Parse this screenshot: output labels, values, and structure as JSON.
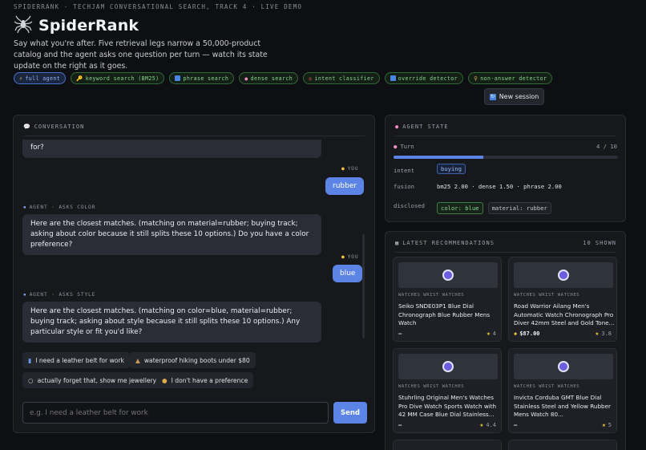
{
  "header": {
    "topline": "SPIDERRANK · TECHJAM CONVERSATIONAL SEARCH, TRACK 4 · LIVE DEMO",
    "title": "SpiderRank",
    "tagline": "Say what you're after. Five retrieval legs narrow a 50,000-product catalog and the agent asks one question per turn — watch its state update on the right as it goes."
  },
  "chips": [
    {
      "label": "full agent",
      "icon": "lightning-icon"
    },
    {
      "label": "keyword search (BM25)",
      "icon": "key-icon"
    },
    {
      "label": "phrase search",
      "icon": "phrase-icon"
    },
    {
      "label": "dense search",
      "icon": "brain-icon"
    },
    {
      "label": "intent classifier",
      "icon": "target-icon"
    },
    {
      "label": "override detector",
      "icon": "override-icon"
    },
    {
      "label": "non-answer detector",
      "icon": "magnifier-icon"
    }
  ],
  "new_session_label": "New session",
  "conversation": {
    "title": "CONVERSATION",
    "messages": {
      "agent_partial": "for?",
      "user1_role": "YOU",
      "user1_text": "rubber",
      "agent1_role": "AGENT · ASKS COLOR",
      "agent1_text": "Here are the closest matches. (matching on material=rubber; buying track; asking about color because it still splits these 10 options.) Do you have a color preference?",
      "user2_role": "YOU",
      "user2_text": "blue",
      "agent2_role": "AGENT · ASKS STYLE",
      "agent2_text": "Here are the closest matches. (matching on color=blue, material=rubber; buying track; asking about style because it still splits these 10 options.) Any particular style or fit you'd like?"
    },
    "suggestions": [
      {
        "label": "I need a leather belt for work",
        "icon": "belt-icon"
      },
      {
        "label": "waterproof hiking boots under $80",
        "icon": "boot-icon"
      },
      {
        "label": "actually forget that, show me jewellery",
        "icon": "ring-icon"
      },
      {
        "label": "I don't have a preference",
        "icon": "shrug-icon"
      }
    ],
    "input_placeholder": "e.g. I need a leather belt for work",
    "send_label": "Send"
  },
  "agent_state": {
    "title": "AGENT STATE",
    "turn_label": "Turn",
    "turn_value": "4 / 10",
    "turn_progress": 0.4,
    "intent_label": "intent",
    "intent_value": "buying",
    "fusion_label": "fusion",
    "fusion_value": "bm25 2.00 · dense 1.50 · phrase 2.00",
    "disclosed_label": "disclosed",
    "disclosed": [
      "color: blue",
      "material: rubber"
    ]
  },
  "recommendations": {
    "title": "LATEST RECOMMENDATIONS",
    "count_label": "10 SHOWN",
    "cards": [
      {
        "category": "WATCHES WRIST WATCHES",
        "title": "Seiko SNDE03P1 Blue Dial Chronograph Blue Rubber Mens Watch",
        "price": "–",
        "rating": "4"
      },
      {
        "category": "WATCHES WRIST WATCHES",
        "title": "Road Warrior Ailang Men's Automatic Watch Chronograph Pro Diver 42mm Steel and Gold Tone...",
        "price": "$87.00",
        "rating": "3.8"
      },
      {
        "category": "WATCHES WRIST WATCHES",
        "title": "Stuhrling Original Men's Watches Pro Dive Watch Sports Watch with 42 MM Case Blue Dial Stainless...",
        "price": "–",
        "rating": "4.4"
      },
      {
        "category": "WATCHES WRIST WATCHES",
        "title": "Invicta Corduba GMT Blue Dial Stainless Steel and Yellow Rubber Mens Watch 80...",
        "price": "–",
        "rating": "5"
      }
    ]
  },
  "colors": {
    "accent": "#5b84e6",
    "leg_green": "#89d38f",
    "background": "#0e0f12"
  }
}
